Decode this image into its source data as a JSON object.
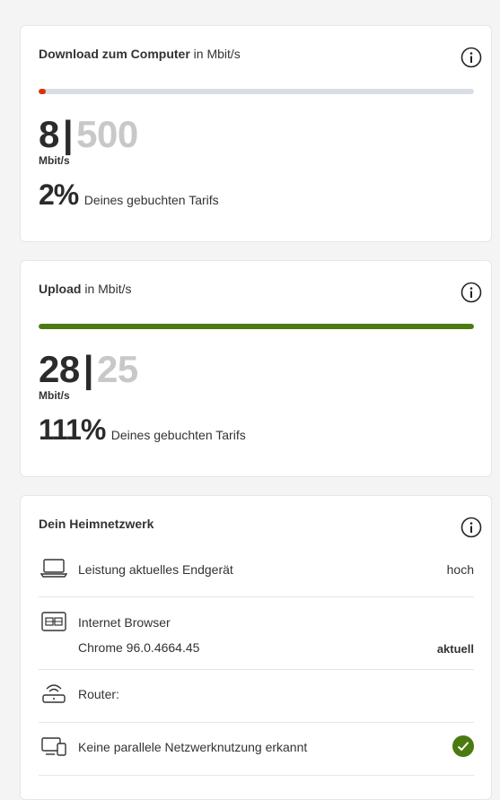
{
  "colors": {
    "download_bar": "#d9340b",
    "upload_bar": "#4e7a12",
    "track": "#d9dde6",
    "check": "#4a7a10"
  },
  "download": {
    "title_bold": "Download zum Computer",
    "title_rest": "in Mbit/s",
    "current": "8",
    "separator": "|",
    "max": "500",
    "unit": "Mbit/s",
    "percent": "2%",
    "percent_text": "Deines gebuchten Tarifs",
    "progress_fraction": 0.016
  },
  "upload": {
    "title_bold": "Upload",
    "title_rest": "in Mbit/s",
    "current": "28",
    "separator": "|",
    "max": "25",
    "unit": "Mbit/s",
    "percent": "111%",
    "percent_text": "Deines gebuchten Tarifs",
    "progress_fraction": 1.0
  },
  "network": {
    "title": "Dein Heimnetzwerk",
    "rows": [
      {
        "icon": "laptop-icon",
        "label": "Leistung aktuelles Endgerät",
        "value": "hoch"
      },
      {
        "icon": "browser-icon",
        "label": "Internet Browser",
        "sublabel": "Chrome 96.0.4664.45",
        "value": "aktuell"
      },
      {
        "icon": "router-icon",
        "label": "Router:",
        "value": ""
      },
      {
        "icon": "devices-icon",
        "label": "Keine parallele Netzwerknutzung erkannt",
        "value": "check-icon"
      }
    ]
  }
}
